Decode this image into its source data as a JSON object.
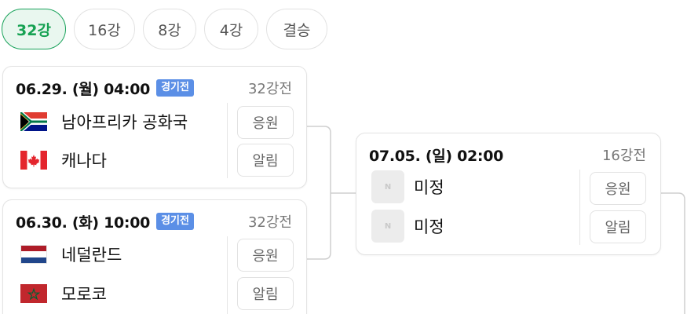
{
  "tabs": [
    {
      "label": "32강",
      "active": true
    },
    {
      "label": "16강",
      "active": false
    },
    {
      "label": "8강",
      "active": false
    },
    {
      "label": "4강",
      "active": false
    },
    {
      "label": "결승",
      "active": false
    }
  ],
  "matches": [
    {
      "date": "06.29. (월) 04:00",
      "status": "경기전",
      "round": "32강전",
      "teams": [
        {
          "name": "남아프리카 공화국",
          "flag": "south-africa-flag-icon"
        },
        {
          "name": "캐나다",
          "flag": "canada-flag-icon"
        }
      ],
      "actions": [
        "응원",
        "알림"
      ]
    },
    {
      "date": "06.30. (화) 10:00",
      "status": "경기전",
      "round": "32강전",
      "teams": [
        {
          "name": "네덜란드",
          "flag": "netherlands-flag-icon"
        },
        {
          "name": "모로코",
          "flag": "morocco-flag-icon"
        }
      ],
      "actions": [
        "응원",
        "알림"
      ]
    },
    {
      "date": "07.05. (일) 02:00",
      "round": "16강전",
      "teams": [
        {
          "name": "미정",
          "flag": "placeholder-logo-icon",
          "logo_text": "N"
        },
        {
          "name": "미정",
          "flag": "placeholder-logo-icon",
          "logo_text": "N"
        }
      ],
      "actions": [
        "응원",
        "알림"
      ]
    }
  ],
  "colors": {
    "active_tab_text": "#17a253",
    "active_tab_border": "#18a25a",
    "active_tab_bg": "#e9f7ef",
    "badge_bg": "#5b8fe6",
    "connector": "#cfcfcf"
  }
}
